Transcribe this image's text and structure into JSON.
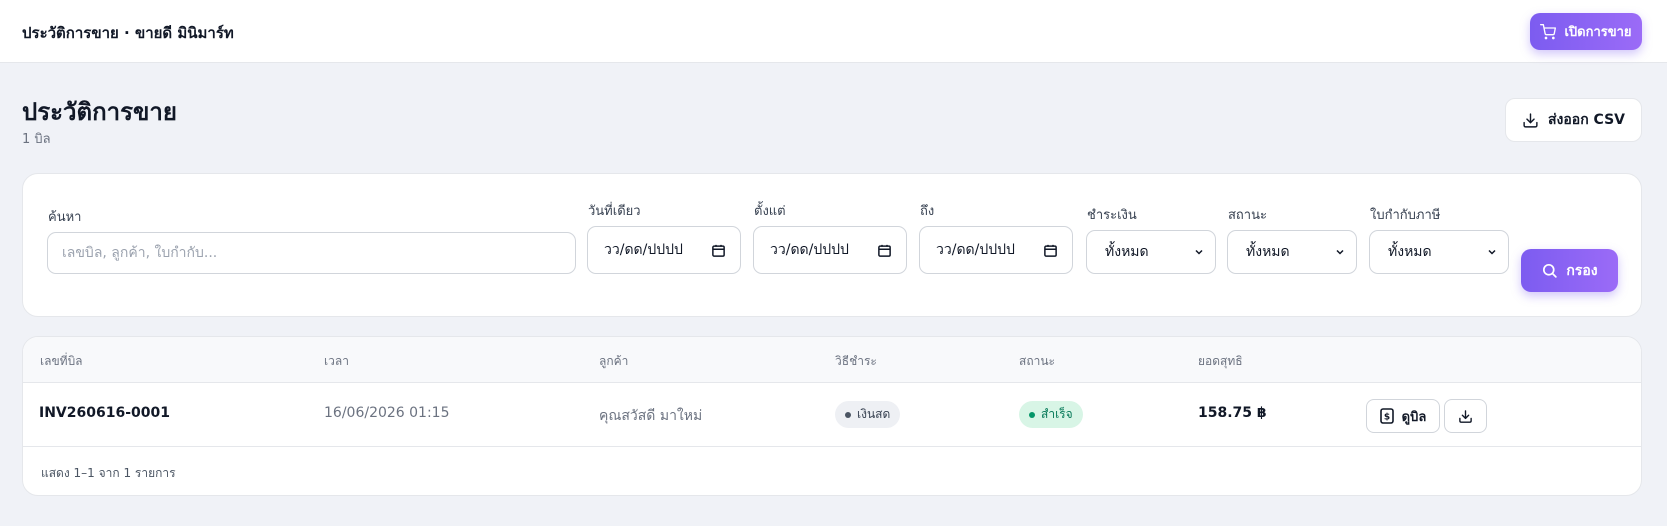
{
  "topbar": {
    "title": "ประวัติการขาย · ขายดี มินิมาร์ท",
    "open_sale_label": "เปิดการขาย",
    "open_sale_icon": "cart-icon"
  },
  "page": {
    "title": "ประวัติการขาย",
    "count": "1 บิล",
    "export_label": "ส่งออก CSV",
    "export_icon": "download-icon"
  },
  "filters": {
    "search": {
      "label": "ค้นหา",
      "placeholder": "เลขบิล, ลูกค้า, ใบกำกับ..."
    },
    "single_date": {
      "label": "วันที่เดียว",
      "value": "วว/ดด/ปปปป"
    },
    "from_date": {
      "label": "ตั้งแต่",
      "value": "วว/ดด/ปปปป"
    },
    "to_date": {
      "label": "ถึง",
      "value": "วว/ดด/ปปปป"
    },
    "payment": {
      "label": "ชำระเงิน",
      "value": "ทั้งหมด"
    },
    "status": {
      "label": "สถานะ",
      "value": "ทั้งหมด"
    },
    "tax_invoice": {
      "label": "ใบกำกับภาษี",
      "value": "ทั้งหมด"
    },
    "filter_label": "กรอง",
    "filter_icon": "search-icon"
  },
  "table": {
    "headers": [
      "เลขที่บิล",
      "เวลา",
      "ลูกค้า",
      "วิธีชำระ",
      "สถานะ",
      "ยอดสุทธิ"
    ],
    "rows": [
      {
        "invoice": "INV260616-0001",
        "time": "16/06/2026 01:15",
        "customer": "คุณสวัสดี มาใหม่",
        "payment": "เงินสด",
        "status": "สำเร็จ",
        "total": "158.75 ฿",
        "view_label": "ดูบิล",
        "view_icon": "receipt-icon",
        "download_icon": "download-icon"
      }
    ],
    "footer": "แสดง 1–1 จาก 1 รายการ"
  },
  "colors": {
    "accent": "#8b5cf6",
    "success_bg": "#d8f5e6",
    "success_text": "#047857",
    "page_bg": "#f0f2f7"
  }
}
